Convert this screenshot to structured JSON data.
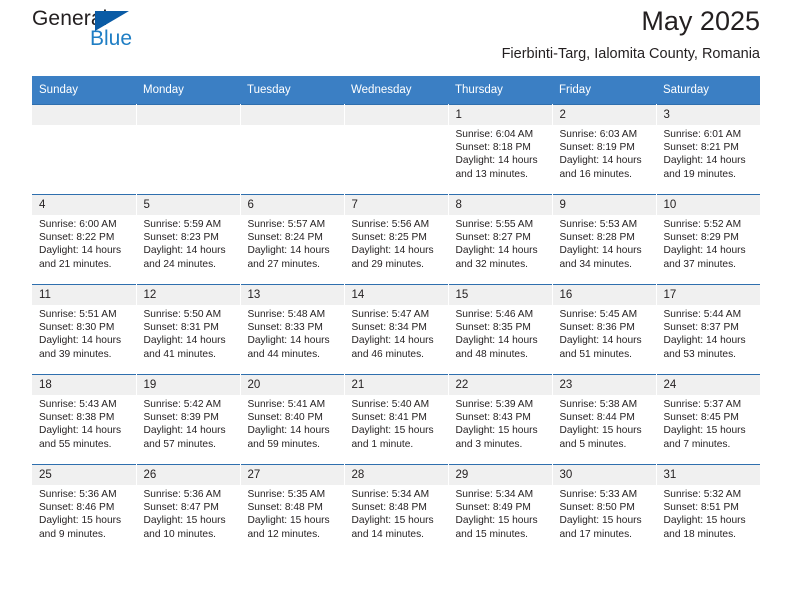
{
  "brand": {
    "name_top": "General",
    "name_bottom": "Blue",
    "accent_color": "#1f7ec4",
    "triangle_color": "#0a5ba5"
  },
  "header": {
    "title": "May 2025",
    "subtitle": "Fierbinti-Targ, Ialomita County, Romania"
  },
  "theme": {
    "header_bg": "#3b7fc4",
    "daynum_bg": "#f0f0f0",
    "row_border": "#2f6fae"
  },
  "labels": {
    "sunrise_prefix": "Sunrise:",
    "sunset_prefix": "Sunset:",
    "daylight_prefix": "Daylight:"
  },
  "weekday_headers": [
    "Sunday",
    "Monday",
    "Tuesday",
    "Wednesday",
    "Thursday",
    "Friday",
    "Saturday"
  ],
  "weeks": [
    [
      {
        "day": "",
        "empty": true
      },
      {
        "day": "",
        "empty": true
      },
      {
        "day": "",
        "empty": true
      },
      {
        "day": "",
        "empty": true
      },
      {
        "day": "1",
        "sunrise": "Sunrise: 6:04 AM",
        "sunset": "Sunset: 8:18 PM",
        "daylight": "Daylight: 14 hours and 13 minutes."
      },
      {
        "day": "2",
        "sunrise": "Sunrise: 6:03 AM",
        "sunset": "Sunset: 8:19 PM",
        "daylight": "Daylight: 14 hours and 16 minutes."
      },
      {
        "day": "3",
        "sunrise": "Sunrise: 6:01 AM",
        "sunset": "Sunset: 8:21 PM",
        "daylight": "Daylight: 14 hours and 19 minutes."
      }
    ],
    [
      {
        "day": "4",
        "sunrise": "Sunrise: 6:00 AM",
        "sunset": "Sunset: 8:22 PM",
        "daylight": "Daylight: 14 hours and 21 minutes."
      },
      {
        "day": "5",
        "sunrise": "Sunrise: 5:59 AM",
        "sunset": "Sunset: 8:23 PM",
        "daylight": "Daylight: 14 hours and 24 minutes."
      },
      {
        "day": "6",
        "sunrise": "Sunrise: 5:57 AM",
        "sunset": "Sunset: 8:24 PM",
        "daylight": "Daylight: 14 hours and 27 minutes."
      },
      {
        "day": "7",
        "sunrise": "Sunrise: 5:56 AM",
        "sunset": "Sunset: 8:25 PM",
        "daylight": "Daylight: 14 hours and 29 minutes."
      },
      {
        "day": "8",
        "sunrise": "Sunrise: 5:55 AM",
        "sunset": "Sunset: 8:27 PM",
        "daylight": "Daylight: 14 hours and 32 minutes."
      },
      {
        "day": "9",
        "sunrise": "Sunrise: 5:53 AM",
        "sunset": "Sunset: 8:28 PM",
        "daylight": "Daylight: 14 hours and 34 minutes."
      },
      {
        "day": "10",
        "sunrise": "Sunrise: 5:52 AM",
        "sunset": "Sunset: 8:29 PM",
        "daylight": "Daylight: 14 hours and 37 minutes."
      }
    ],
    [
      {
        "day": "11",
        "sunrise": "Sunrise: 5:51 AM",
        "sunset": "Sunset: 8:30 PM",
        "daylight": "Daylight: 14 hours and 39 minutes."
      },
      {
        "day": "12",
        "sunrise": "Sunrise: 5:50 AM",
        "sunset": "Sunset: 8:31 PM",
        "daylight": "Daylight: 14 hours and 41 minutes."
      },
      {
        "day": "13",
        "sunrise": "Sunrise: 5:48 AM",
        "sunset": "Sunset: 8:33 PM",
        "daylight": "Daylight: 14 hours and 44 minutes."
      },
      {
        "day": "14",
        "sunrise": "Sunrise: 5:47 AM",
        "sunset": "Sunset: 8:34 PM",
        "daylight": "Daylight: 14 hours and 46 minutes."
      },
      {
        "day": "15",
        "sunrise": "Sunrise: 5:46 AM",
        "sunset": "Sunset: 8:35 PM",
        "daylight": "Daylight: 14 hours and 48 minutes."
      },
      {
        "day": "16",
        "sunrise": "Sunrise: 5:45 AM",
        "sunset": "Sunset: 8:36 PM",
        "daylight": "Daylight: 14 hours and 51 minutes."
      },
      {
        "day": "17",
        "sunrise": "Sunrise: 5:44 AM",
        "sunset": "Sunset: 8:37 PM",
        "daylight": "Daylight: 14 hours and 53 minutes."
      }
    ],
    [
      {
        "day": "18",
        "sunrise": "Sunrise: 5:43 AM",
        "sunset": "Sunset: 8:38 PM",
        "daylight": "Daylight: 14 hours and 55 minutes."
      },
      {
        "day": "19",
        "sunrise": "Sunrise: 5:42 AM",
        "sunset": "Sunset: 8:39 PM",
        "daylight": "Daylight: 14 hours and 57 minutes."
      },
      {
        "day": "20",
        "sunrise": "Sunrise: 5:41 AM",
        "sunset": "Sunset: 8:40 PM",
        "daylight": "Daylight: 14 hours and 59 minutes."
      },
      {
        "day": "21",
        "sunrise": "Sunrise: 5:40 AM",
        "sunset": "Sunset: 8:41 PM",
        "daylight": "Daylight: 15 hours and 1 minute."
      },
      {
        "day": "22",
        "sunrise": "Sunrise: 5:39 AM",
        "sunset": "Sunset: 8:43 PM",
        "daylight": "Daylight: 15 hours and 3 minutes."
      },
      {
        "day": "23",
        "sunrise": "Sunrise: 5:38 AM",
        "sunset": "Sunset: 8:44 PM",
        "daylight": "Daylight: 15 hours and 5 minutes."
      },
      {
        "day": "24",
        "sunrise": "Sunrise: 5:37 AM",
        "sunset": "Sunset: 8:45 PM",
        "daylight": "Daylight: 15 hours and 7 minutes."
      }
    ],
    [
      {
        "day": "25",
        "sunrise": "Sunrise: 5:36 AM",
        "sunset": "Sunset: 8:46 PM",
        "daylight": "Daylight: 15 hours and 9 minutes."
      },
      {
        "day": "26",
        "sunrise": "Sunrise: 5:36 AM",
        "sunset": "Sunset: 8:47 PM",
        "daylight": "Daylight: 15 hours and 10 minutes."
      },
      {
        "day": "27",
        "sunrise": "Sunrise: 5:35 AM",
        "sunset": "Sunset: 8:48 PM",
        "daylight": "Daylight: 15 hours and 12 minutes."
      },
      {
        "day": "28",
        "sunrise": "Sunrise: 5:34 AM",
        "sunset": "Sunset: 8:48 PM",
        "daylight": "Daylight: 15 hours and 14 minutes."
      },
      {
        "day": "29",
        "sunrise": "Sunrise: 5:34 AM",
        "sunset": "Sunset: 8:49 PM",
        "daylight": "Daylight: 15 hours and 15 minutes."
      },
      {
        "day": "30",
        "sunrise": "Sunrise: 5:33 AM",
        "sunset": "Sunset: 8:50 PM",
        "daylight": "Daylight: 15 hours and 17 minutes."
      },
      {
        "day": "31",
        "sunrise": "Sunrise: 5:32 AM",
        "sunset": "Sunset: 8:51 PM",
        "daylight": "Daylight: 15 hours and 18 minutes."
      }
    ]
  ]
}
